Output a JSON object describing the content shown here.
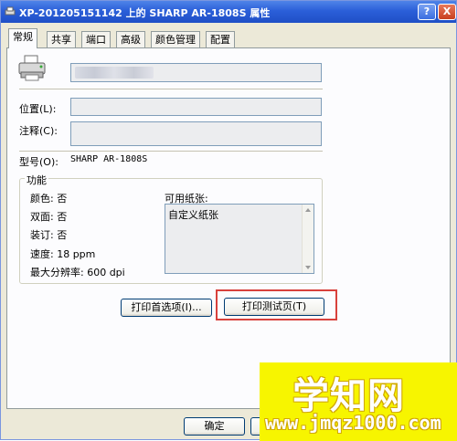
{
  "window": {
    "title": "XP-201205151142 上的 SHARP AR-1808S 属性",
    "help_btn": "?",
    "close_btn": "X"
  },
  "tabs": [
    "常规",
    "共享",
    "端口",
    "高级",
    "颜色管理",
    "配置"
  ],
  "general": {
    "printer_name": "",
    "location_label": "位置(L):",
    "location_value": "",
    "comment_label": "注释(C):",
    "comment_value": "",
    "model_label": "型号(O):",
    "model_value": "SHARP AR-1808S"
  },
  "features": {
    "legend": "功能",
    "color": "颜色: 否",
    "duplex": "双面: 否",
    "staple": "装订: 否",
    "speed": "速度: 18 ppm",
    "max_res": "最大分辨率: 600 dpi",
    "paper_label": "可用纸张:",
    "paper_items": [
      "自定义纸张"
    ]
  },
  "buttons": {
    "print_prefs": "打印首选项(I)...",
    "print_test": "打印测试页(T)",
    "ok": "确定",
    "cancel": ""
  },
  "watermark": {
    "big": "学知网",
    "small": "www.jmqz1000.com"
  },
  "colors": {
    "titlebar": "#2b5fd9",
    "highlight": "#d8413c",
    "watermark_bg": "#f7f500"
  }
}
